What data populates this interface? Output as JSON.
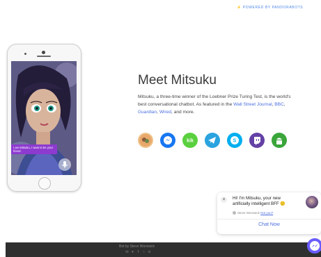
{
  "header": {
    "powered_by": "⚡ POWERED BY PANDORABOTS"
  },
  "phone": {
    "bubble_text": "I am Mitsuku, I want to be your friend."
  },
  "main": {
    "title": "Meet Mitsuku",
    "desc_intro": "Mitsuku, a three-time winner of the Loebner Prize Turing Test, is the world's best conversational chatbot. As featured in the ",
    "link_wsj": "Wall Street Journal",
    "sep1": ", ",
    "link_bbc": "BBC",
    "sep2": ", ",
    "link_guardian": "Guardian",
    "sep3": ", ",
    "link_wired": "Wired",
    "desc_outro": ", and more."
  },
  "platforms": [
    {
      "name": "web-avatar-icon",
      "color": "#e8a86b"
    },
    {
      "name": "messenger-icon",
      "color": "#1877f2"
    },
    {
      "name": "kik-icon",
      "color": "#5bd03f"
    },
    {
      "name": "telegram-icon",
      "color": "#2aa3df"
    },
    {
      "name": "skype-icon",
      "color": "#00aff0"
    },
    {
      "name": "twitch-icon",
      "color": "#6441a5"
    },
    {
      "name": "android-icon",
      "color": "#3aa53a"
    }
  ],
  "chat_widget": {
    "close": "×",
    "message": "Hi! I'm Mitsuku, your new artificially intelligent BFF 🙂",
    "meta_name": "Steve Worswick",
    "meta_link": "Not you?",
    "cta": "Chat Now"
  },
  "footer": {
    "credit": "Bot by Steve Worswick"
  }
}
